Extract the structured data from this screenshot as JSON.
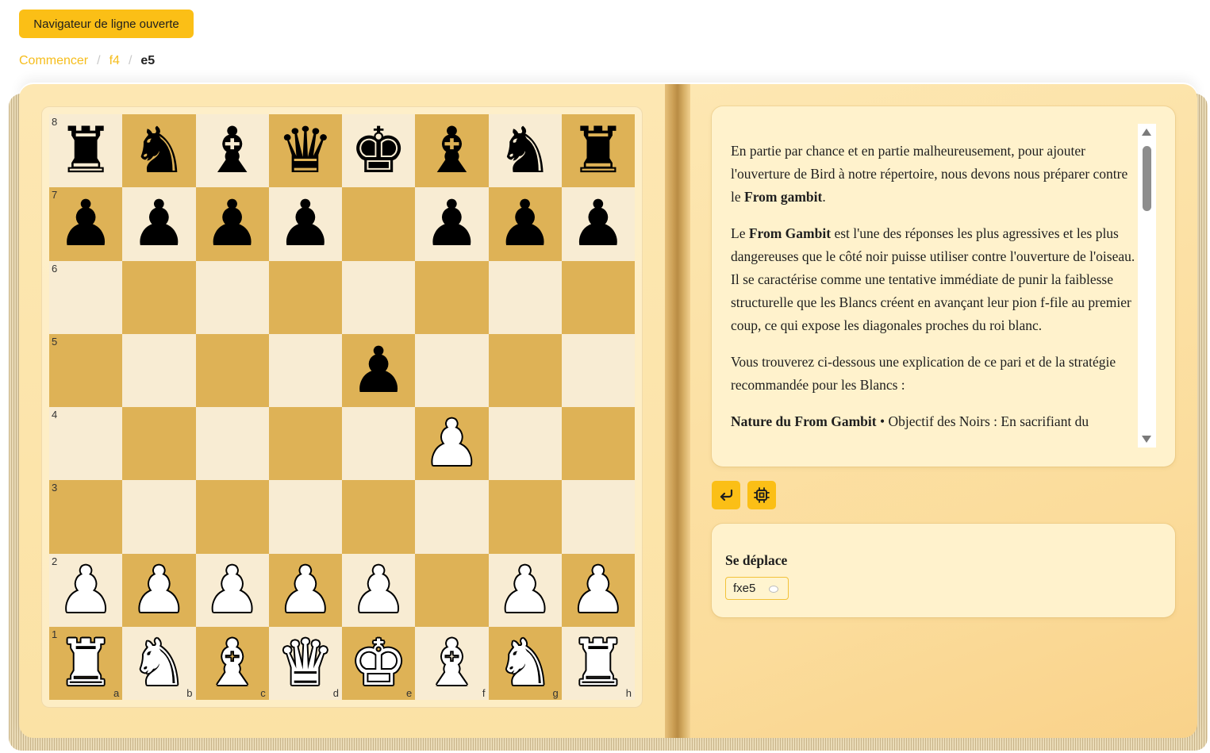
{
  "top_button": {
    "label": "Navigateur de ligne ouverte"
  },
  "breadcrumb": {
    "links": [
      "Commencer",
      "f4"
    ],
    "separator": "/",
    "current": "e5"
  },
  "board": {
    "ranks": [
      "8",
      "7",
      "6",
      "5",
      "4",
      "3",
      "2",
      "1"
    ],
    "files": [
      "a",
      "b",
      "c",
      "d",
      "e",
      "f",
      "g",
      "h"
    ],
    "position": [
      [
        "bR",
        "bN",
        "bB",
        "bQ",
        "bK",
        "bB",
        "bN",
        "bR"
      ],
      [
        "bP",
        "bP",
        "bP",
        "bP",
        "",
        "bP",
        "bP",
        "bP"
      ],
      [
        "",
        "",
        "",
        "",
        "",
        "",
        "",
        ""
      ],
      [
        "",
        "",
        "",
        "",
        "bP",
        "",
        "",
        ""
      ],
      [
        "",
        "",
        "",
        "",
        "",
        "wP",
        "",
        ""
      ],
      [
        "",
        "",
        "",
        "",
        "",
        "",
        "",
        ""
      ],
      [
        "wP",
        "wP",
        "wP",
        "wP",
        "wP",
        "",
        "wP",
        "wP"
      ],
      [
        "wR",
        "wN",
        "wB",
        "wQ",
        "wK",
        "wB",
        "wN",
        "wR"
      ]
    ]
  },
  "commentary": {
    "p1": {
      "t1": "En partie par chance et en partie malheureusement, pour ajouter l'ouverture de Bird à notre répertoire, nous devons nous préparer contre le ",
      "b1": "From gambit",
      "t2": "."
    },
    "p2": {
      "t1": "Le ",
      "b1": "From Gambit",
      "t2": " est l'une des réponses les plus agressives et les plus dangereuses que le côté noir puisse utiliser contre l'ouverture de l'oiseau. Il se caractérise comme une tentative immédiate de punir la faiblesse structurelle que les Blancs créent en avançant leur pion f-file au premier coup, ce qui expose les diagonales proches du roi blanc."
    },
    "p3": {
      "t1": "Vous trouverez ci-dessous une explication de ce pari et de la stratégie recommandée pour les Blancs :"
    },
    "p4": {
      "b1": "Nature du From Gambit",
      "t1": " • Objectif des Noirs : En sacrifiant du"
    }
  },
  "actions": {
    "undo_icon": "undo-arrow-icon",
    "engine_icon": "engine-chip-icon"
  },
  "moves": {
    "title": "Se déplace",
    "items": [
      {
        "label": "fxe5",
        "icon": "comment-bubble-icon"
      }
    ]
  },
  "colors": {
    "accent": "#fbbf16",
    "light_square": "#f8ecd3",
    "dark_square": "#deb256",
    "page": "#fde7b2"
  }
}
